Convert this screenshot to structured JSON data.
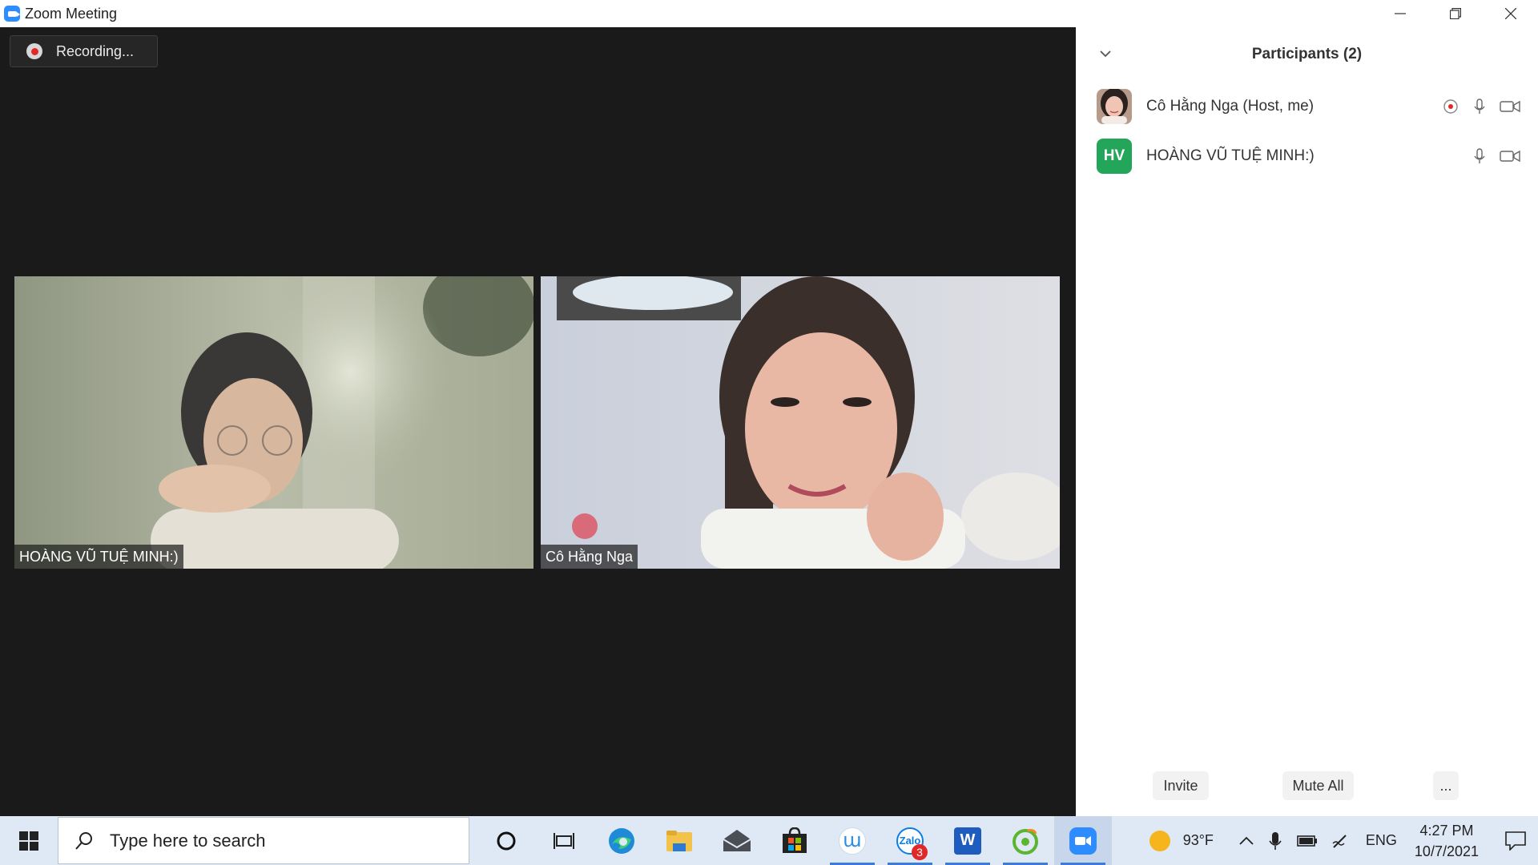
{
  "window": {
    "title": "Zoom Meeting"
  },
  "meeting": {
    "recording_label": "Recording...",
    "tiles": [
      {
        "label": "HOÀNG VŨ TUỆ MINH:)"
      },
      {
        "label": "Cô Hằng Nga"
      }
    ]
  },
  "participants_panel": {
    "title": "Participants (2)",
    "participants": [
      {
        "name": "Cô Hằng Nga (Host, me)",
        "avatar": "photo",
        "recording": true,
        "mic": "mic-icon",
        "video": "video-icon"
      },
      {
        "name": "HOÀNG VŨ TUỆ MINH:)",
        "avatar_initials": "HV",
        "avatar_color": "#23a55a",
        "mic": "mic-icon",
        "video": "video-icon"
      }
    ],
    "buttons": {
      "invite": "Invite",
      "mute_all": "Mute All",
      "more": "..."
    }
  },
  "taskbar": {
    "search_placeholder": "Type here to search",
    "apps": [
      {
        "name": "cortana",
        "icon": "circle-icon"
      },
      {
        "name": "task-view",
        "icon": "task-view-icon"
      },
      {
        "name": "edge",
        "icon": "edge-icon"
      },
      {
        "name": "file-explorer",
        "icon": "folder-icon"
      },
      {
        "name": "mail",
        "icon": "mail-icon"
      },
      {
        "name": "store",
        "icon": "store-icon"
      },
      {
        "name": "app-w",
        "icon": "w-app-icon",
        "active": true
      },
      {
        "name": "zalo",
        "icon": "zalo-icon",
        "badge": "3",
        "active": true
      },
      {
        "name": "word",
        "icon": "word-icon",
        "active": true
      },
      {
        "name": "app-green",
        "icon": "green-app-icon",
        "active": true
      },
      {
        "name": "zoom",
        "icon": "zoom-icon",
        "active": true
      }
    ],
    "tray": {
      "temperature": "93°F",
      "language": "ENG",
      "time": "4:27 PM",
      "date": "10/7/2021"
    }
  }
}
